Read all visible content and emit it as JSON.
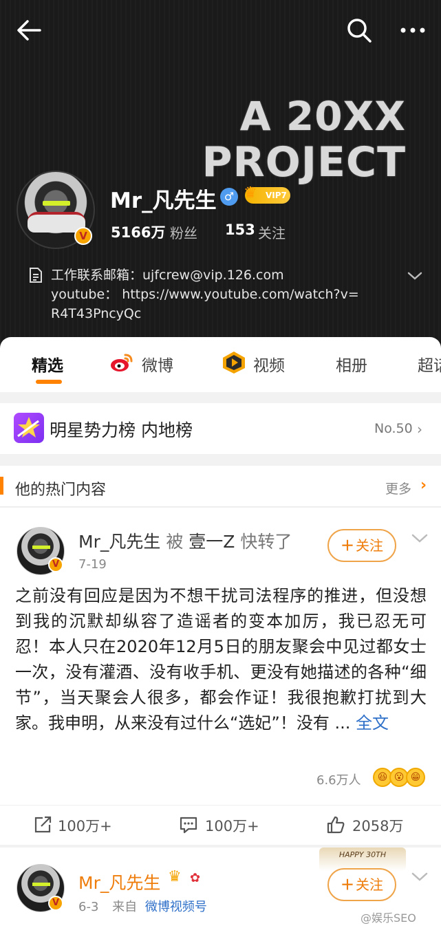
{
  "header": {
    "banner_line1": "A 20XX",
    "banner_line2": "PROJECT",
    "username": "Mr_凡先生",
    "gender": "♂",
    "vip_label": "VIP7",
    "fans_count": "5166万",
    "fans_label": "粉丝",
    "follow_count": "153",
    "follow_label": "关注",
    "bio_line1": "工作联系邮箱：ujfcrew@vip.126.com",
    "bio_line2": "youtube：  https://www.youtube.com/watch?v=",
    "bio_line3": "R4T43PncyQc"
  },
  "tabs": [
    {
      "label": "精选",
      "active": true
    },
    {
      "label": "微博"
    },
    {
      "label": "视频"
    },
    {
      "label": "相册"
    },
    {
      "label": "超话"
    }
  ],
  "ranking": {
    "title": "明星势力榜 内地榜",
    "rank": "No.50"
  },
  "hot": {
    "title": "他的热门内容",
    "more": "更多"
  },
  "post": {
    "author": "Mr_凡先生",
    "relation_word": "被",
    "reposter": "壹一Z",
    "relation_tail": "快转了",
    "date": "7-19",
    "follow_label": "关注",
    "body": "之前没有回应是因为不想干扰司法程序的推进，但没想到我的沉默却纵容了造谣者的变本加厉，我已忍无可忍！本人只在2020年12月5日的朋友聚会中见过都女士一次，没有灌酒、没有收手机、更没有她描述的各种“细节”，当天聚会人很多，都会作证！我很抱歉打扰到大家。我申明，从来没有过什么“选妃”！没有 ... ",
    "full_text_link": "全文",
    "reactions_count": "6.6万人",
    "repost_count": "100万+",
    "comment_count": "100万+",
    "like_count": "2058万"
  },
  "post2": {
    "author": "Mr_凡先生",
    "date": "6-3",
    "from_label": "来自",
    "source": "微博视频号",
    "follow_label": "关注",
    "sticker_text": "HAPPY 30TH"
  },
  "watermark": "@娱乐SEO",
  "colors": {
    "accent": "#ff8200",
    "link": "#2f70c9",
    "header_bg": "#1a1a1a"
  }
}
